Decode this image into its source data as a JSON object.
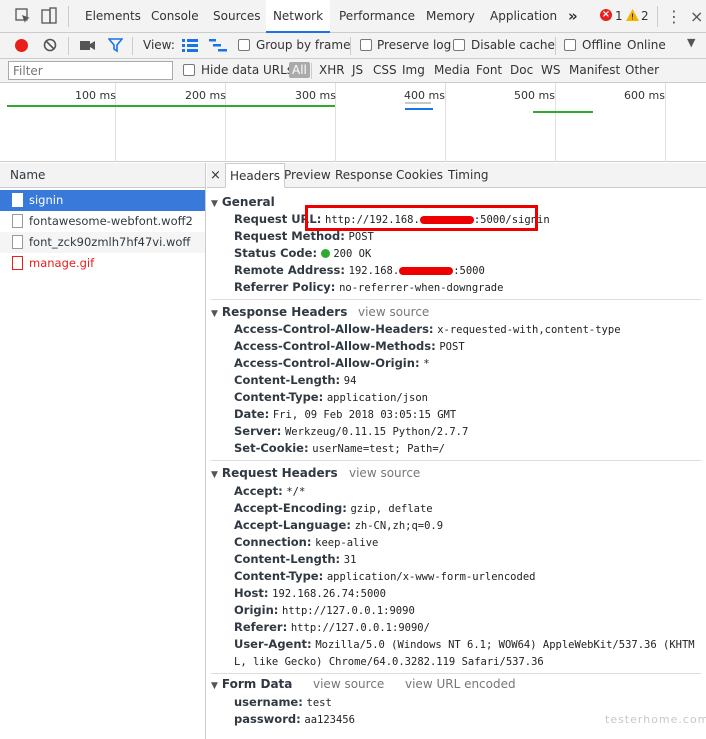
{
  "main_tabs": [
    "Elements",
    "Console",
    "Sources",
    "Network",
    "Performance",
    "Memory",
    "Application"
  ],
  "more_tabs": "»",
  "errors_count": "1",
  "warnings_count": "2",
  "close_glyph": "⋮",
  "toolbar": {
    "view_label": "View:",
    "group_by_frame": "Group by frame",
    "preserve_log": "Preserve log",
    "disable_cache": "Disable cache",
    "offline": "Offline",
    "throttle_value": "Online"
  },
  "filter": {
    "placeholder": "Filter",
    "hide_data_urls": "Hide data URLs",
    "types": [
      "All",
      "XHR",
      "JS",
      "CSS",
      "Img",
      "Media",
      "Font",
      "Doc",
      "WS",
      "Manifest",
      "Other"
    ]
  },
  "overview": {
    "ticks": [
      "100 ms",
      "200 ms",
      "300 ms",
      "400 ms",
      "500 ms",
      "600 ms"
    ]
  },
  "requests": {
    "header": "Name",
    "items": [
      {
        "name": "signin"
      },
      {
        "name": "fontawesome-webfont.woff2"
      },
      {
        "name": "font_zck90zmlh7hf47vi.woff"
      },
      {
        "name": "manage.gif"
      }
    ]
  },
  "detail_tabs": {
    "close": "×",
    "tabs": [
      "Headers",
      "Preview",
      "Response",
      "Cookies",
      "Timing"
    ]
  },
  "general": {
    "title": "General",
    "request_url_key": "Request URL:",
    "request_url_a": "http://192.168.",
    "request_url_b": ":5000/signin",
    "request_method_key": "Request Method:",
    "request_method": "POST",
    "status_code_key": "Status Code:",
    "status_code": "200 OK",
    "remote_address_key": "Remote Address:",
    "remote_address_a": "192.168.",
    "remote_address_b": ":5000",
    "referrer_policy_key": "Referrer Policy:",
    "referrer_policy": "no-referrer-when-downgrade"
  },
  "response_headers": {
    "title": "Response Headers",
    "view_source": "view source",
    "rows": [
      {
        "k": "Access-Control-Allow-Headers:",
        "v": "x-requested-with,content-type"
      },
      {
        "k": "Access-Control-Allow-Methods:",
        "v": "POST"
      },
      {
        "k": "Access-Control-Allow-Origin:",
        "v": "*"
      },
      {
        "k": "Content-Length:",
        "v": "94"
      },
      {
        "k": "Content-Type:",
        "v": "application/json"
      },
      {
        "k": "Date:",
        "v": "Fri, 09 Feb 2018 03:05:15 GMT"
      },
      {
        "k": "Server:",
        "v": "Werkzeug/0.11.15 Python/2.7.7"
      },
      {
        "k": "Set-Cookie:",
        "v": "userName=test; Path=/"
      }
    ]
  },
  "request_headers": {
    "title": "Request Headers",
    "view_source": "view source",
    "rows": [
      {
        "k": "Accept:",
        "v": "*/*"
      },
      {
        "k": "Accept-Encoding:",
        "v": "gzip, deflate"
      },
      {
        "k": "Accept-Language:",
        "v": "zh-CN,zh;q=0.9"
      },
      {
        "k": "Connection:",
        "v": "keep-alive"
      },
      {
        "k": "Content-Length:",
        "v": "31"
      },
      {
        "k": "Content-Type:",
        "v": "application/x-www-form-urlencoded"
      },
      {
        "k": "Host:",
        "v": "192.168.26.74:5000"
      },
      {
        "k": "Origin:",
        "v": "http://127.0.0.1:9090"
      },
      {
        "k": "Referer:",
        "v": "http://127.0.0.1:9090/"
      },
      {
        "k": "User-Agent:",
        "v": "Mozilla/5.0 (Windows NT 6.1; WOW64) AppleWebKit/537.36 (KHTM"
      }
    ],
    "ua_continued": "L, like Gecko) Chrome/64.0.3282.119 Safari/537.36"
  },
  "form_data": {
    "title": "Form Data",
    "view_source": "view source",
    "view_url_encoded": "view URL encoded",
    "rows": [
      {
        "k": "username:",
        "v": "test"
      },
      {
        "k": "password:",
        "v": "aa123456"
      }
    ]
  },
  "watermark": "testerhome.com",
  "colors": {
    "accent": "#1a73e8",
    "selected_row": "#3879d9",
    "error": "#e8201a",
    "highlight": "#e00000",
    "status_ok": "#2eaa2e"
  }
}
